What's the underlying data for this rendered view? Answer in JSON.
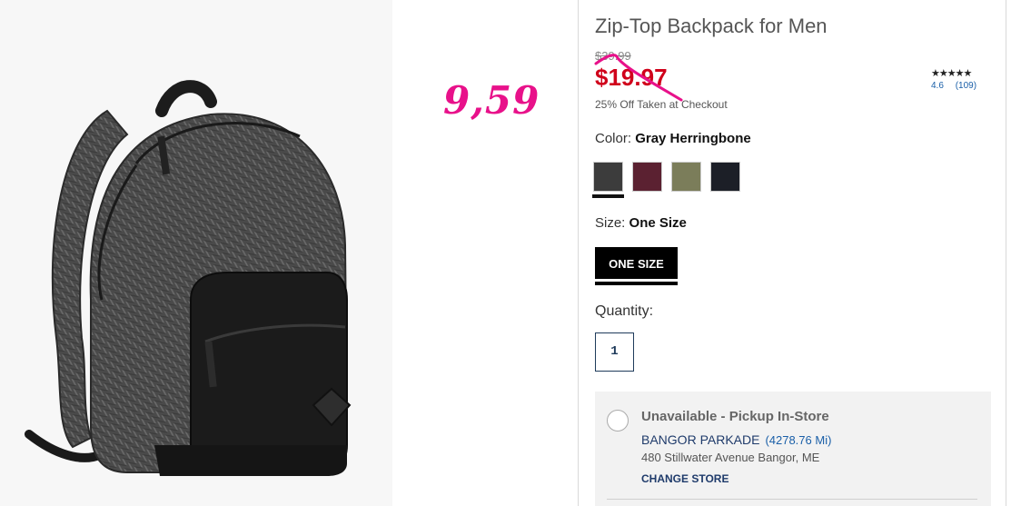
{
  "annotation": {
    "handwritten_price": "9,59"
  },
  "product": {
    "title": "Zip-Top Backpack for Men",
    "original_price": "$39.99",
    "sale_price": "$19.97",
    "promo": "25% Off Taken at Checkout",
    "rating": {
      "stars": "★★★★★",
      "score": "4.6",
      "count": "(109)"
    }
  },
  "color": {
    "label": "Color:",
    "selected": "Gray Herringbone",
    "swatches": [
      {
        "name": "Gray Herringbone",
        "hex": "#3c3c3c",
        "selected": true
      },
      {
        "name": "Burgundy",
        "hex": "#5b2131",
        "selected": false
      },
      {
        "name": "Olive",
        "hex": "#7b7d5a",
        "selected": false
      },
      {
        "name": "Navy",
        "hex": "#1c1f27",
        "selected": false
      }
    ]
  },
  "size": {
    "label": "Size:",
    "selected": "One Size",
    "options": [
      "ONE SIZE"
    ]
  },
  "quantity": {
    "label": "Quantity:",
    "value": "1"
  },
  "pickup": {
    "status": "Unavailable - Pickup In-Store",
    "store_name": "BANGOR PARKADE",
    "distance": "(4278.76 Mi)",
    "address": "480 Stillwater Avenue Bangor, ME",
    "change_label": "CHANGE STORE"
  },
  "colors": {
    "sale_red": "#d0021b",
    "annotation_pink": "#e8118a",
    "link_blue": "#1a5fa8",
    "navy": "#1f3b5b"
  }
}
